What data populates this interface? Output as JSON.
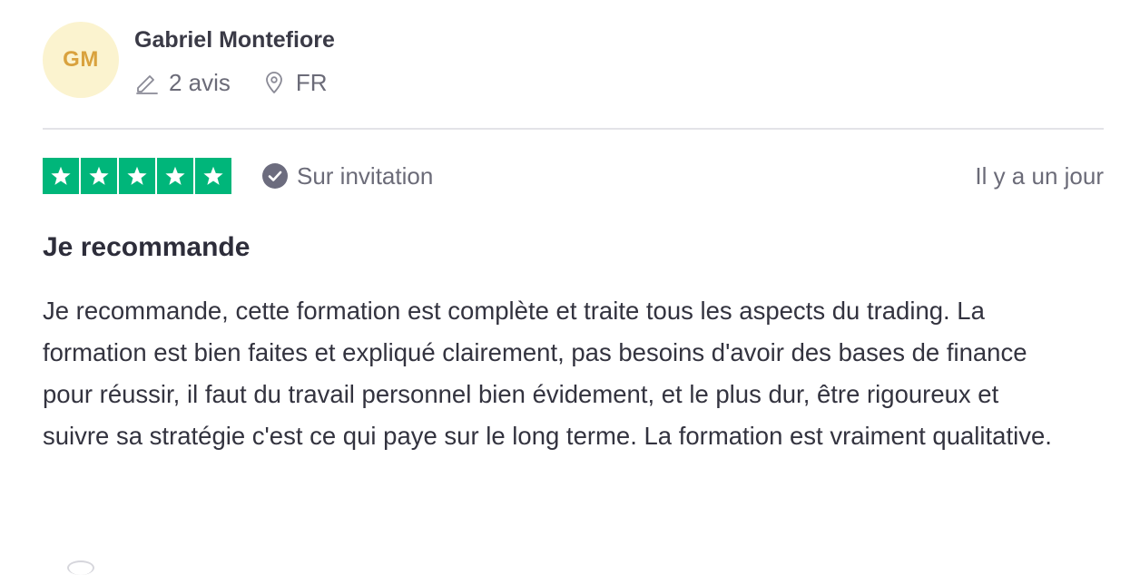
{
  "reviewer": {
    "initials": "GM",
    "name": "Gabriel Montefiore",
    "reviews_count": "2 avis",
    "country": "FR"
  },
  "review": {
    "rating": 5,
    "rating_color": "#00b67a",
    "verification_label": "Sur invitation",
    "date": "Il y a un jour",
    "title": "Je recommande",
    "body": "Je recommande, cette formation est complète et traite tous les aspects du trading. La formation est bien faites et expliqué clairement, pas besoins d'avoir des bases de finance pour réussir, il faut du travail personnel bien évidement, et le plus dur, être rigoureux et suivre sa stratégie c'est ce qui paye sur le long terme. La formation est vraiment qualitative."
  },
  "icons": {
    "reviews": "pencil-icon",
    "location": "location-pin-icon",
    "verified": "check-circle-icon",
    "star": "star-icon"
  },
  "colors": {
    "avatar_bg": "#fbf3cf",
    "avatar_text": "#d9a23e",
    "muted_text": "#6b6b78"
  }
}
